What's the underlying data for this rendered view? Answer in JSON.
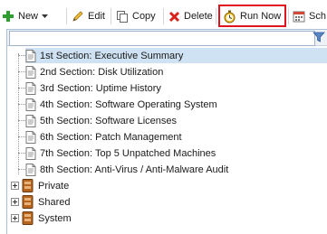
{
  "toolbar": {
    "new_label": "New",
    "edit_label": "Edit",
    "copy_label": "Copy",
    "delete_label": "Delete",
    "run_now_label": "Run Now",
    "schedule_label": "Sch"
  },
  "filter": {
    "value": "",
    "placeholder": ""
  },
  "tree": {
    "sections": [
      {
        "label": "1st Section: Executive Summary",
        "selected": true
      },
      {
        "label": "2nd Section: Disk Utilization"
      },
      {
        "label": "3rd Section: Uptime History"
      },
      {
        "label": "4th Section: Software Operating System"
      },
      {
        "label": "5th Section: Software Licenses"
      },
      {
        "label": "6th Section: Patch Management"
      },
      {
        "label": "7th Section: Top 5 Unpatched Machines"
      },
      {
        "label": "8th Section: Anti-Virus / Anti-Malware Audit"
      }
    ],
    "folders": [
      {
        "label": "Private"
      },
      {
        "label": "Shared"
      },
      {
        "label": "System"
      }
    ]
  },
  "colors": {
    "highlight_border": "#e0141e",
    "selected_row": "#cfe2f3",
    "folder": "#b5651d"
  }
}
